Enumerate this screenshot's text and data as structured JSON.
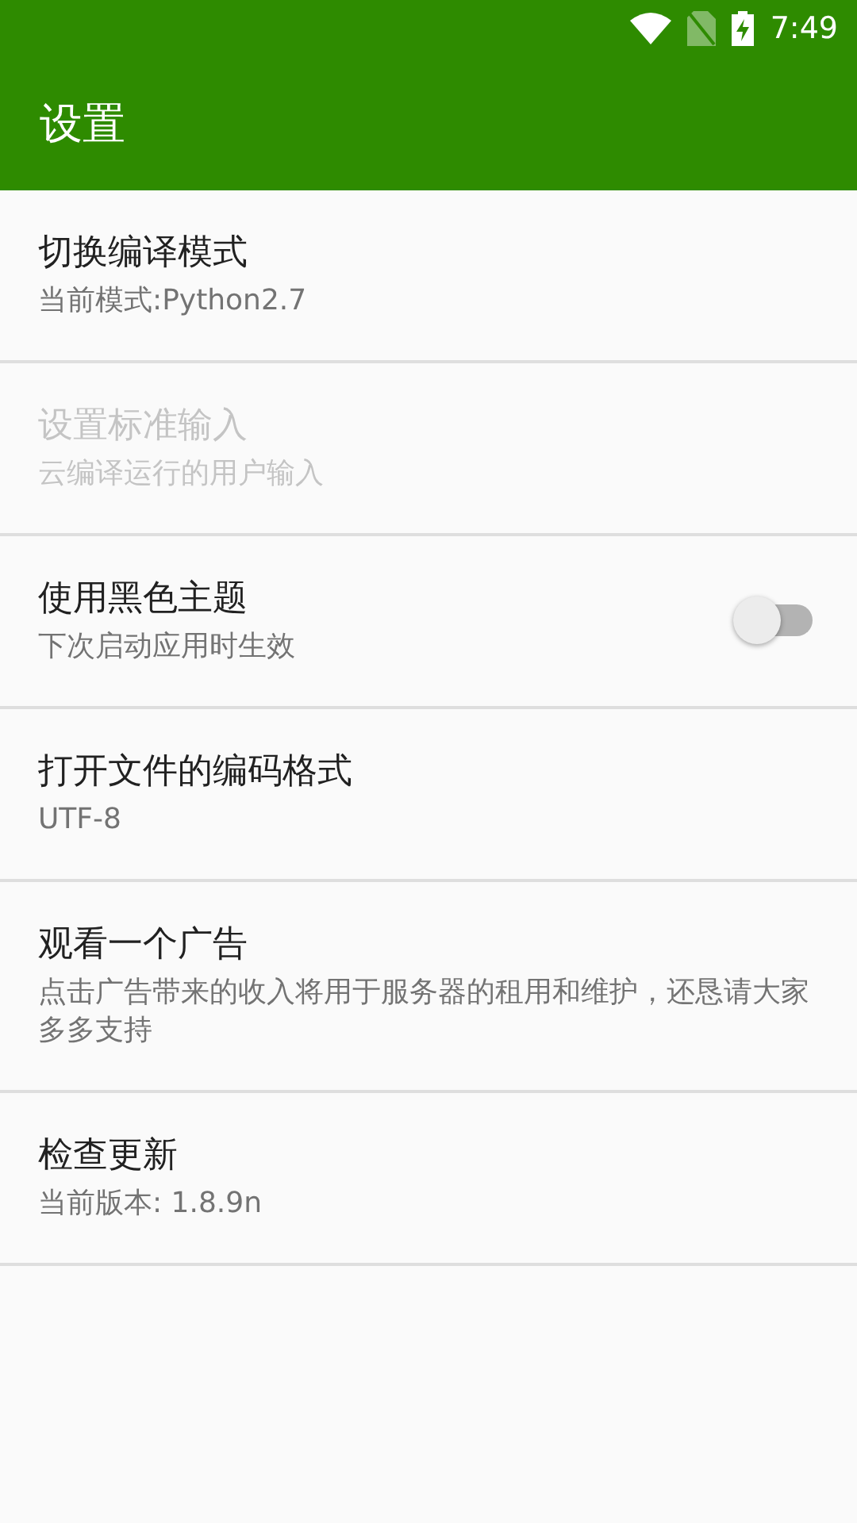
{
  "status_bar": {
    "time": "7:49"
  },
  "app_bar": {
    "title": "设置"
  },
  "settings": [
    {
      "kind": "text",
      "title": "切换编译模式",
      "summary": "当前模式:Python2.7",
      "disabled": false
    },
    {
      "kind": "text",
      "title": "设置标准输入",
      "summary": "云编译运行的用户输入",
      "disabled": true
    },
    {
      "kind": "switch",
      "title": "使用黑色主题",
      "summary": "下次启动应用时生效",
      "disabled": false,
      "on": false
    },
    {
      "kind": "text",
      "title": "打开文件的编码格式",
      "summary": "UTF-8",
      "disabled": false
    },
    {
      "kind": "text",
      "title": "观看一个广告",
      "summary": "点击广告带来的收入将用于服务器的租用和维护，还恳请大家多多支持",
      "disabled": false
    },
    {
      "kind": "text",
      "title": "检查更新",
      "summary": "当前版本: 1.8.9n",
      "disabled": false
    }
  ]
}
